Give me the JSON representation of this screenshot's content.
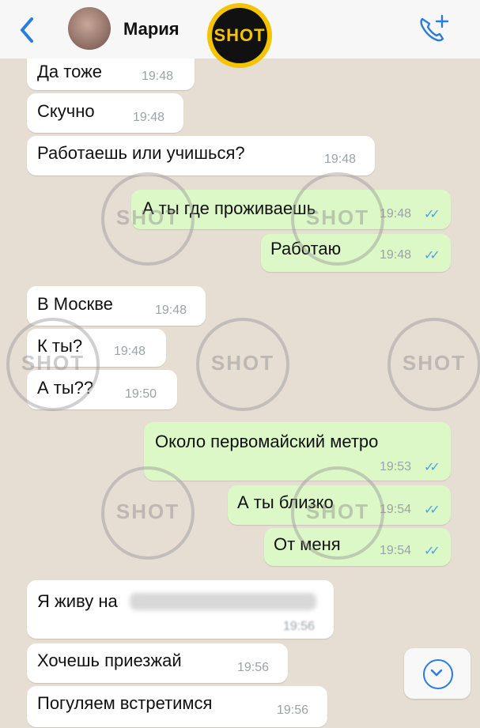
{
  "header": {
    "contact_name": "Мария",
    "logo_text": "SHOT",
    "back_icon": "chevron-left-icon",
    "call_icon": "phone-plus-icon",
    "accent": "#2b7ce0"
  },
  "watermark_text": "SHOT",
  "messages": [
    {
      "dir": "in",
      "text": "Да тоже",
      "time": "19:48"
    },
    {
      "dir": "in",
      "text": "Скучно",
      "time": "19:48"
    },
    {
      "dir": "in",
      "text": "Работаешь или учишься?",
      "time": "19:48"
    },
    {
      "dir": "out",
      "text": "А ты где проживаешь",
      "time": "19:48"
    },
    {
      "dir": "out",
      "text": "Работаю",
      "time": "19:48"
    },
    {
      "dir": "in",
      "text": "В Москве",
      "time": "19:48"
    },
    {
      "dir": "in",
      "text": "К ты?",
      "time": "19:48"
    },
    {
      "dir": "in",
      "text": "А ты??",
      "time": "19:50"
    },
    {
      "dir": "out",
      "text": "Около первомайский метро",
      "time": "19:53"
    },
    {
      "dir": "out",
      "text": "А ты близко",
      "time": "19:54"
    },
    {
      "dir": "out",
      "text": "От меня",
      "time": "19:54"
    },
    {
      "dir": "in",
      "text": "Я живу на",
      "time": "19:56"
    },
    {
      "dir": "in",
      "text": "Хочешь приезжай",
      "time": "19:56"
    },
    {
      "dir": "in",
      "text": "Погуляем встретимся",
      "time": "19:56"
    }
  ],
  "colors": {
    "incoming": "#ffffff",
    "outgoing": "#dcf8c6",
    "read_ticks": "#4fa3e0"
  }
}
